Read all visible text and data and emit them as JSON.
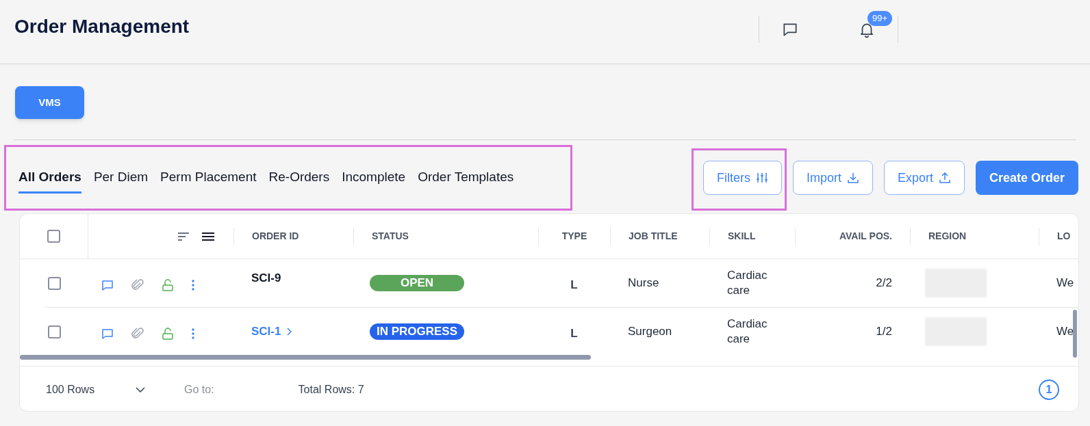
{
  "header": {
    "title": "Order Management",
    "notification_badge": "99+"
  },
  "vms_button": "VMS",
  "tabs": [
    {
      "label": "All Orders",
      "selected": true
    },
    {
      "label": "Per Diem",
      "selected": false
    },
    {
      "label": "Perm Placement",
      "selected": false
    },
    {
      "label": "Re-Orders",
      "selected": false
    },
    {
      "label": "Incomplete",
      "selected": false
    },
    {
      "label": "Order Templates",
      "selected": false
    }
  ],
  "actions": [
    {
      "label": "Filters",
      "kind": "outline"
    },
    {
      "label": "Import",
      "kind": "outline"
    },
    {
      "label": "Export",
      "kind": "outline"
    },
    {
      "label": "Create Order",
      "kind": "primary"
    }
  ],
  "table": {
    "select_all": {
      "checked": false
    },
    "columns": [
      "ORDER ID",
      "STATUS",
      "TYPE",
      "JOB TITLE",
      "SKILL",
      "AVAIL POS.",
      "REGION",
      "LO"
    ],
    "rows": [
      {
        "checked": false,
        "order_id": "SCI-9",
        "kind": "plain",
        "status": "OPEN",
        "color": "#5ba55b",
        "type": "L",
        "job_title": "Nurse",
        "skill": "Cardiac care",
        "avail_pos": "2/2",
        "location": "We"
      },
      {
        "checked": false,
        "order_id": "SCI-1",
        "kind": "link",
        "status": "IN PROGRESS",
        "color": "#2563eb",
        "type": "L",
        "job_title": "Surgeon",
        "skill": "Cardiac care",
        "avail_pos": "1/2",
        "location": "We"
      }
    ]
  },
  "footer": {
    "rows_per_page": "100 Rows",
    "goto": "Go to:",
    "total": "Total Rows: 7",
    "pages": [
      {
        "label": "1",
        "selected": true
      }
    ]
  }
}
